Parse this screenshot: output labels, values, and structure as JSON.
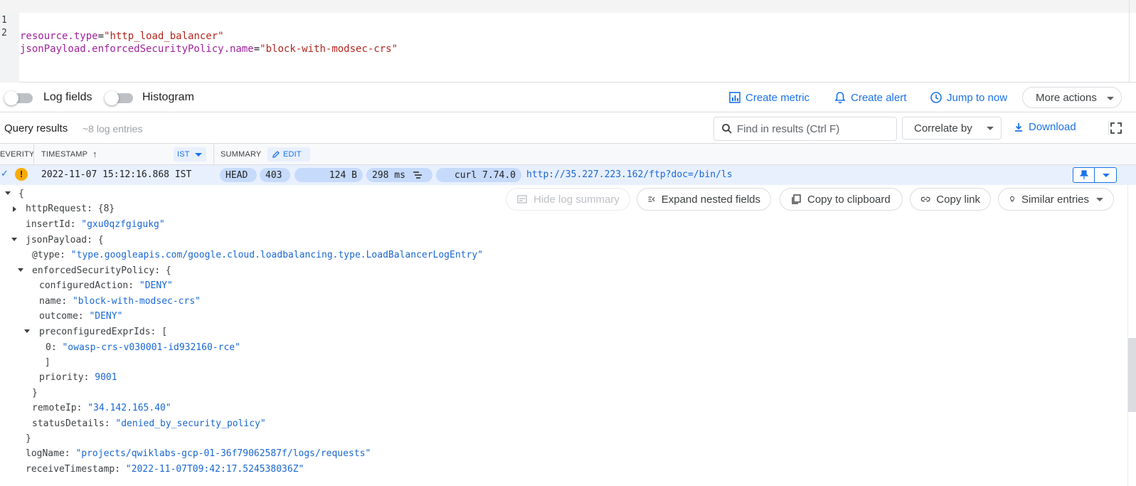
{
  "editor": {
    "lines": [
      {
        "num": "1",
        "key": "resource.type",
        "eq": "=",
        "val": "\"http_load_balancer\""
      },
      {
        "num": "2",
        "key": "jsonPayload.enforcedSecurityPolicy.name",
        "eq": "=",
        "val": "\"block-with-modsec-crs\""
      }
    ]
  },
  "toolbar": {
    "log_fields": "Log fields",
    "histogram": "Histogram",
    "create_metric": "Create metric",
    "create_alert": "Create alert",
    "jump_to_now": "Jump to now",
    "more_actions": "More actions"
  },
  "results": {
    "title": "Query results",
    "count": "~8 log entries",
    "find_placeholder": "Find in results (Ctrl F)",
    "correlate": "Correlate by",
    "download": "Download"
  },
  "columns": {
    "severity": "EVERITY",
    "timestamp": "TIMESTAMP",
    "tz": "IST",
    "summary": "SUMMARY",
    "edit": "EDIT"
  },
  "log_row": {
    "timestamp": "2022-11-07 15:12:16.868 IST",
    "method": "HEAD",
    "status": "403",
    "size": "124 B",
    "latency": "298 ms",
    "agent": "curl 7.74.0",
    "url": "http://35.227.223.162/ftp?doc=/bin/ls"
  },
  "actions": {
    "hide_summary": "Hide log summary",
    "expand_nested": "Expand nested fields",
    "copy_clipboard": "Copy to clipboard",
    "copy_link": "Copy link",
    "similar": "Similar entries"
  },
  "detail": {
    "open_brace": "{",
    "httpRequest_key": "httpRequest",
    "httpRequest_val": "{8}",
    "insertId_key": "insertId",
    "insertId_val": "\"gxu0qzfgigukg\"",
    "jsonPayload_key": "jsonPayload",
    "type_key": "@type",
    "type_val": "\"type.googleapis.com/google.cloud.loadbalancing.type.LoadBalancerLogEntry\"",
    "esp_key": "enforcedSecurityPolicy",
    "configuredAction_key": "configuredAction",
    "configuredAction_val": "\"DENY\"",
    "name_key": "name",
    "name_val": "\"block-with-modsec-crs\"",
    "outcome_key": "outcome",
    "outcome_val": "\"DENY\"",
    "preExpr_key": "preconfiguredExprIds",
    "preExpr_0_key": "0",
    "preExpr_0_val": "\"owasp-crs-v030001-id932160-rce\"",
    "priority_key": "priority",
    "priority_val": "9001",
    "remoteIp_key": "remoteIp",
    "remoteIp_val": "\"34.142.165.40\"",
    "statusDetails_key": "statusDetails",
    "statusDetails_val": "\"denied_by_security_policy\"",
    "logName_key": "logName",
    "logName_val": "\"projects/qwiklabs-gcp-01-36f79062587f/logs/requests\"",
    "receiveTimestamp_key": "receiveTimestamp",
    "receiveTimestamp_val": "\"2022-11-07T09:42:17.524538036Z\""
  },
  "colors": {
    "accent": "#1a73e8",
    "warning": "#f9ab00",
    "chip": "#c6dafc"
  }
}
